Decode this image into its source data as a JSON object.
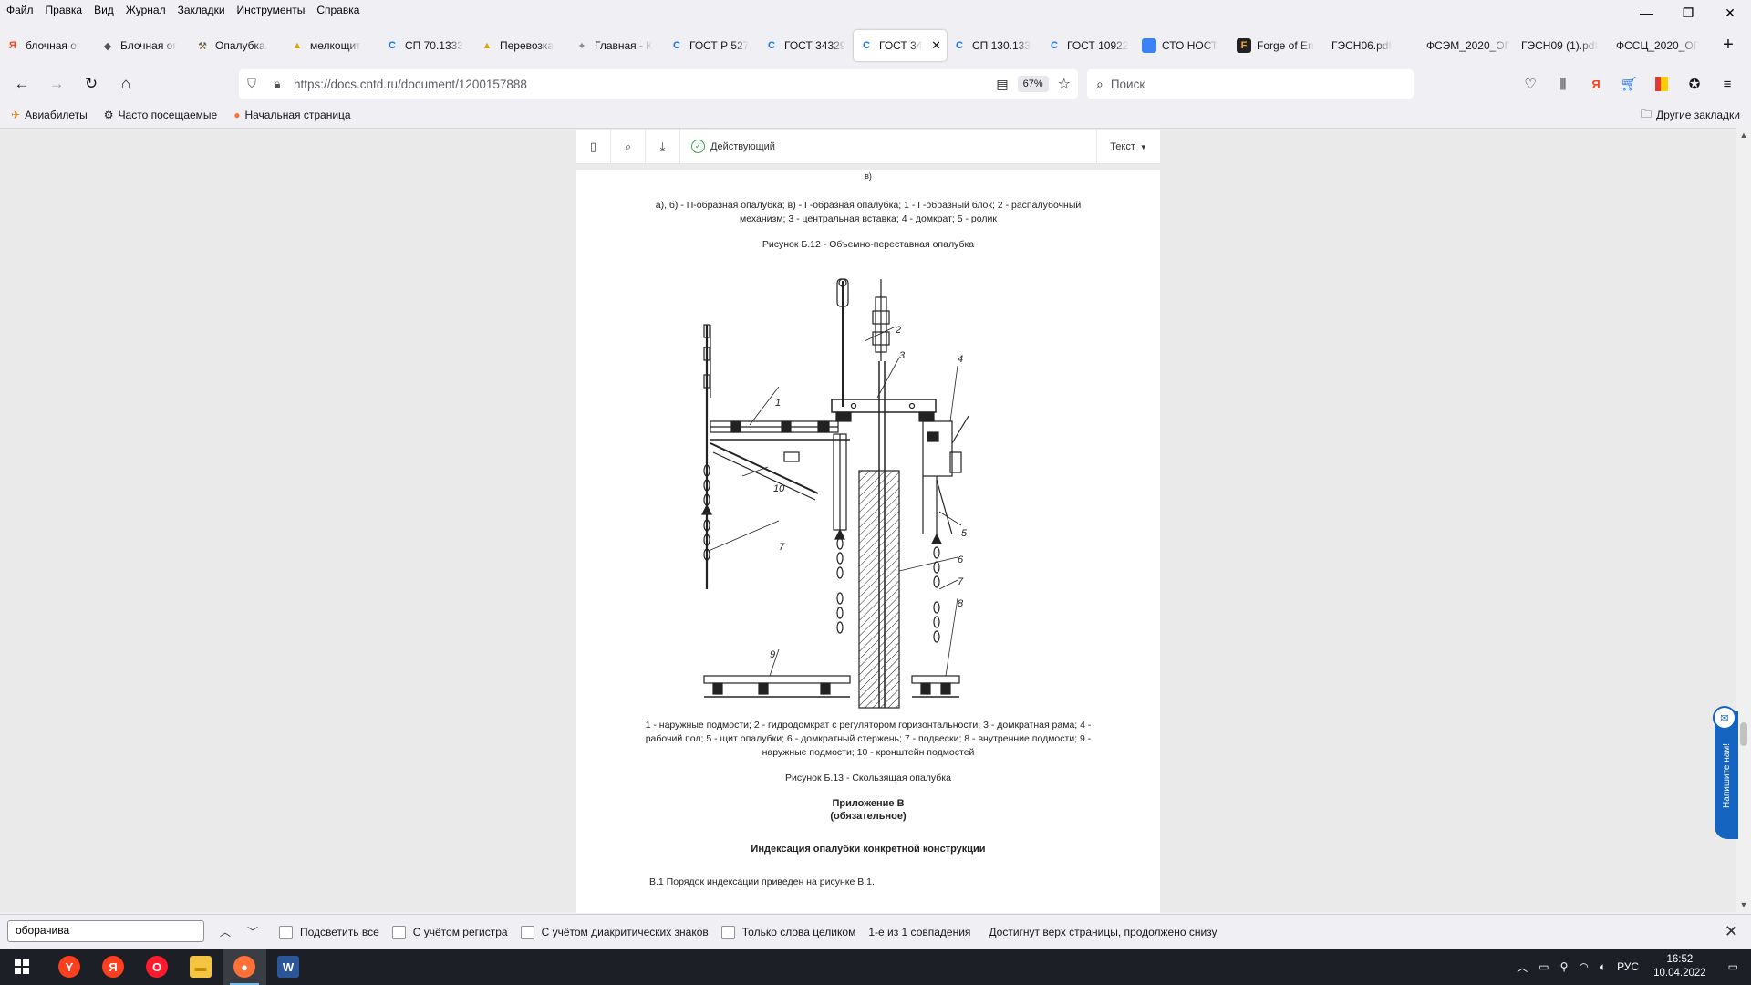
{
  "menu": [
    "Файл",
    "Правка",
    "Вид",
    "Журнал",
    "Закладки",
    "Инструменты",
    "Справка"
  ],
  "tabs": [
    {
      "label": "блочная ог",
      "icon": "yandex-icon",
      "color": "#fc3f1d",
      "glyph": "Я"
    },
    {
      "label": "Блочная ог",
      "icon": "bird-icon",
      "color": "#555555",
      "glyph": "◆"
    },
    {
      "label": "Опалубка.",
      "icon": "tool-icon",
      "color": "#6b5a3a",
      "glyph": "⚒"
    },
    {
      "label": "мелкощит",
      "icon": "image-icon",
      "color": "#e0a800",
      "glyph": "▲"
    },
    {
      "label": "СП 70.1333",
      "icon": "cntd-icon",
      "color": "#1a73e8",
      "glyph": "C"
    },
    {
      "label": "Перевозка",
      "icon": "image-icon",
      "color": "#e0a800",
      "glyph": "▲"
    },
    {
      "label": "Главная - К",
      "icon": "emblem-icon",
      "color": "#888888",
      "glyph": "✦"
    },
    {
      "label": "ГОСТ Р 527",
      "icon": "cntd-icon",
      "color": "#1a73e8",
      "glyph": "C"
    },
    {
      "label": "ГОСТ 34329",
      "icon": "cntd-icon",
      "color": "#1a73e8",
      "glyph": "C"
    },
    {
      "label": "ГОСТ 34",
      "icon": "cntd-icon",
      "color": "#1a73e8",
      "glyph": "C",
      "active": true
    },
    {
      "label": "СП 130.133",
      "icon": "cntd-icon",
      "color": "#1a73e8",
      "glyph": "C"
    },
    {
      "label": "ГОСТ 10922",
      "icon": "cntd-icon",
      "color": "#1a73e8",
      "glyph": "C"
    },
    {
      "label": "СТО НОСТ",
      "icon": "cube-icon",
      "color": "#3b82f6",
      "glyph": "■"
    },
    {
      "label": "Forge of En",
      "icon": "forge-icon",
      "color": "#222222",
      "glyph": "F"
    },
    {
      "label": "ГЭСН06.pdf",
      "icon": "pdf-icon",
      "color": "#ffffff",
      "glyph": ""
    },
    {
      "label": "ФСЭМ_2020_ОГ",
      "icon": "pdf-icon",
      "color": "#ffffff",
      "glyph": ""
    },
    {
      "label": "ГЭСН09 (1).pdf",
      "icon": "pdf-icon",
      "color": "#ffffff",
      "glyph": ""
    },
    {
      "label": "ФССЦ_2020_ОГ",
      "icon": "pdf-icon",
      "color": "#ffffff",
      "glyph": ""
    }
  ],
  "url": "https://docs.cntd.ru/document/1200157888",
  "zoom": "67%",
  "search_placeholder": "Поиск",
  "bookmarks": [
    {
      "label": "Авиабилеты",
      "icon": "plane-icon",
      "glyph": "✈"
    },
    {
      "label": "Часто посещаемые",
      "icon": "gear-icon",
      "glyph": "⚙"
    },
    {
      "label": "Начальная страница",
      "icon": "firefox-icon",
      "glyph": "●"
    }
  ],
  "other_bookmarks": "Другие закладки",
  "doc_toolbar": {
    "status": "Действующий",
    "mode": "Текст"
  },
  "page": {
    "top_fragment": "в)",
    "caption_b12_line1": "а), б) - П-образная опалубка; в) - Г-образная опалубка; 1 - Г-образный блок; 2 - распалубочный",
    "caption_b12_line2": "механизм; 3 - центральная вставка; 4 - домкрат; 5 - ролик",
    "figure_b12": "Рисунок Б.12 - Объемно-переставная опалубка",
    "legend_line1": "1 - наружные подмости; 2 - гидродомкрат с регулятором горизонтальности; 3 - домкратная рама; 4 -",
    "legend_line2": "рабочий пол; 5 - щит опалубки; 6 - домкратный стержень; 7 - подвески; 8 - внутренние подмости; 9 -",
    "legend_line3": "наружные подмости; 10 - кронштейн подмостей",
    "figure_b13": "Рисунок Б.13 - Скользящая опалубка",
    "appendix_title": "Приложение В",
    "appendix_sub": "(обязательное)",
    "section_title": "Индексация опалубки конкретной конструкции",
    "para_b1": "В.1 Порядок индексации приведен на рисунке В.1.",
    "drawing_labels": [
      "1",
      "2",
      "3",
      "4",
      "5",
      "6",
      "7",
      "7",
      "8",
      "9",
      "10"
    ]
  },
  "feedback": "Напишите нам!",
  "findbar": {
    "query": "оборачива",
    "options": [
      "Подсветить все",
      "С учётом регистра",
      "С учётом диакритических знаков",
      "Только слова целиком"
    ],
    "result": "1-е из 1 совпадения",
    "note": "Достигнут верх страницы, продолжено снизу"
  },
  "taskbar": {
    "apps": [
      {
        "name": "yandex-browser",
        "color": "#fc3f1d",
        "glyph": "Y"
      },
      {
        "name": "yandex",
        "color": "#fc3f1d",
        "glyph": "Я"
      },
      {
        "name": "opera",
        "color": "#ff1b2d",
        "glyph": "O"
      },
      {
        "name": "explorer",
        "color": "#f5c542",
        "glyph": "▬"
      },
      {
        "name": "firefox",
        "color": "#ff7139",
        "glyph": "●",
        "active": true
      },
      {
        "name": "word",
        "color": "#2b579a",
        "glyph": "W"
      }
    ],
    "lang": "РУС",
    "time": "16:52",
    "date": "10.04.2022"
  }
}
